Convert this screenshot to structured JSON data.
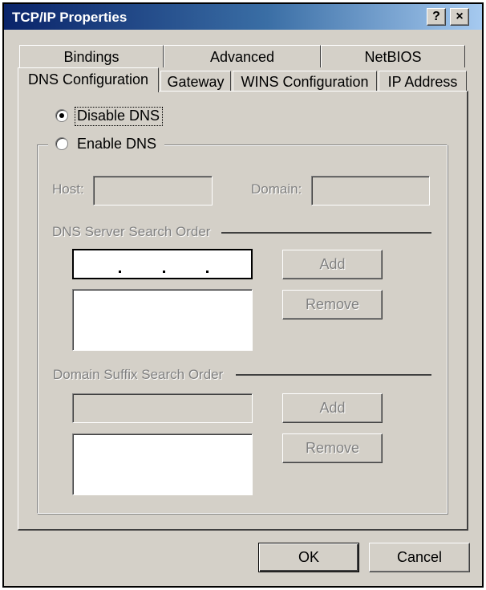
{
  "window": {
    "title": "TCP/IP Properties",
    "help_glyph": "?",
    "close_glyph": "×"
  },
  "tabs": {
    "back": [
      "Bindings",
      "Advanced",
      "NetBIOS"
    ],
    "front": [
      "DNS Configuration",
      "Gateway",
      "WINS Configuration",
      "IP Address"
    ],
    "active": "DNS Configuration"
  },
  "dns": {
    "disable_label": "Disable DNS",
    "enable_label": "Enable DNS",
    "selected": "disable",
    "host_label": "Host:",
    "host_value": "",
    "domain_label": "Domain:",
    "domain_value": "",
    "server_order_label": "DNS Server Search Order",
    "server_ip": [
      "",
      "",
      "",
      ""
    ],
    "server_add": "Add",
    "server_remove": "Remove",
    "suffix_order_label": "Domain Suffix Search Order",
    "suffix_add": "Add",
    "suffix_remove": "Remove"
  },
  "footer": {
    "ok": "OK",
    "cancel": "Cancel"
  },
  "colors": {
    "face": "#d4d0c8",
    "title_start": "#0a246a",
    "title_end": "#a6caf0",
    "disabled_text": "#808080"
  }
}
